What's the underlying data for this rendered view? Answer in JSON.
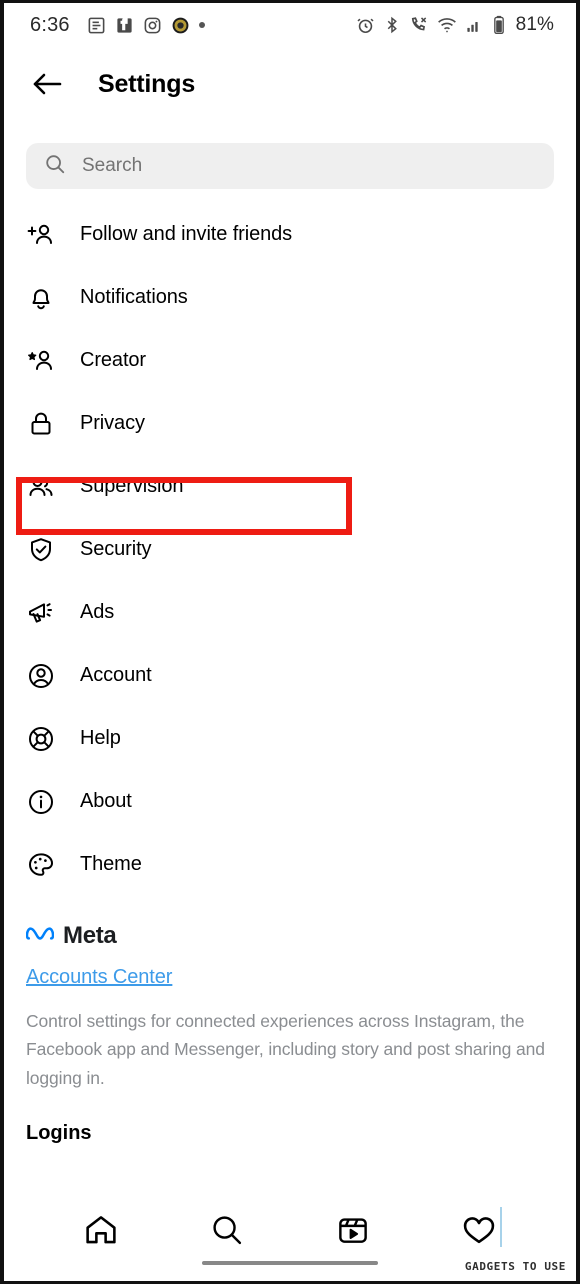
{
  "status_bar": {
    "time": "6:36",
    "left_icons": [
      "feed-icon",
      "messenger-icon",
      "instagram-icon",
      "app-badge-icon",
      "more-dot-icon"
    ],
    "right_icons": [
      "alarm-icon",
      "bluetooth-icon",
      "call-mute-icon",
      "wifi-icon",
      "signal-icon",
      "battery-icon"
    ],
    "battery_label": "81%"
  },
  "header": {
    "back_icon": "back-arrow-icon",
    "title": "Settings"
  },
  "search": {
    "icon": "search-icon",
    "placeholder": "Search",
    "value": ""
  },
  "menu": {
    "items": [
      {
        "label": "Follow and invite friends",
        "icon": "person-add-icon"
      },
      {
        "label": "Notifications",
        "icon": "bell-icon"
      },
      {
        "label": "Creator",
        "icon": "person-star-icon"
      },
      {
        "label": "Privacy",
        "icon": "lock-icon"
      },
      {
        "label": "Supervision",
        "icon": "people-icon",
        "highlighted": true
      },
      {
        "label": "Security",
        "icon": "shield-check-icon"
      },
      {
        "label": "Ads",
        "icon": "megaphone-icon"
      },
      {
        "label": "Account",
        "icon": "account-circle-icon"
      },
      {
        "label": "Help",
        "icon": "lifebuoy-icon"
      },
      {
        "label": "About",
        "icon": "info-circle-icon"
      },
      {
        "label": "Theme",
        "icon": "palette-icon"
      }
    ]
  },
  "meta_section": {
    "logo_icon": "meta-infinity-icon",
    "brand": "Meta",
    "accounts_center_link": "Accounts Center",
    "description": "Control settings for connected experiences across Instagram, the Facebook app and Messenger, including story and post sharing and logging in.",
    "logins_title": "Logins"
  },
  "bottom_nav": {
    "items": [
      {
        "icon": "home-icon",
        "name": "home"
      },
      {
        "icon": "search-icon",
        "name": "search"
      },
      {
        "icon": "reels-icon",
        "name": "reels"
      },
      {
        "icon": "heart-icon",
        "name": "activity"
      }
    ]
  },
  "watermark": {
    "text": "GADGETS TO USE"
  },
  "colors": {
    "highlight": "#ee1c13",
    "link": "#3d9be9",
    "meta_blue": "#0081fb",
    "search_bg": "#efefef",
    "muted_text": "#8a8d91"
  }
}
